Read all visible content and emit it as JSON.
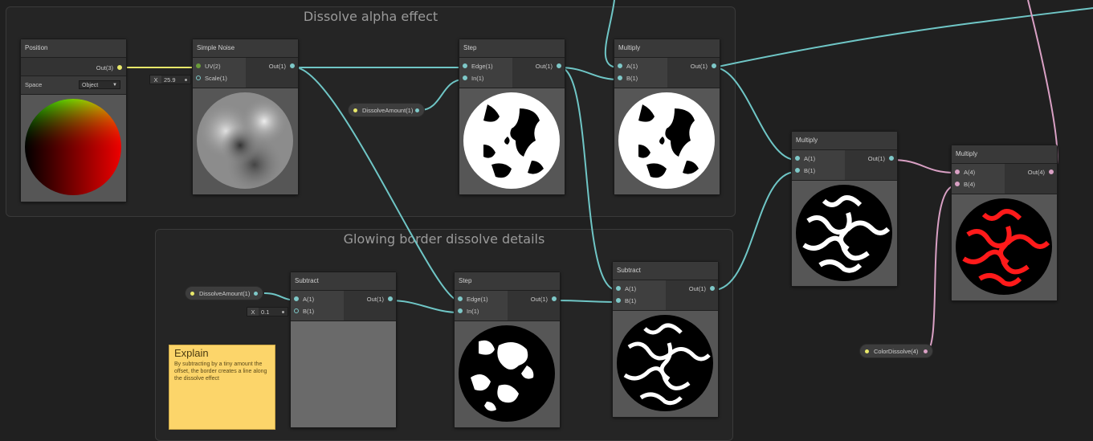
{
  "groups": {
    "dissolve_alpha": {
      "title": "Dissolve alpha effect"
    },
    "glowing_border": {
      "title": "Glowing border dissolve details"
    }
  },
  "nodes": {
    "position": {
      "title": "Position",
      "out": "Out(3)",
      "space_label": "Space",
      "space_value": "Object"
    },
    "simple_noise": {
      "title": "Simple Noise",
      "in1": "UV(2)",
      "in2": "Scale(1)",
      "out": "Out(1)",
      "scale_axis": "X",
      "scale_value": "25.9"
    },
    "step_top": {
      "title": "Step",
      "in1": "Edge(1)",
      "in2": "In(1)",
      "out": "Out(1)"
    },
    "multiply_top": {
      "title": "Multiply",
      "in1": "A(1)",
      "in2": "B(1)",
      "out": "Out(1)"
    },
    "multiply_mid": {
      "title": "Multiply",
      "in1": "A(1)",
      "in2": "B(1)",
      "out": "Out(1)"
    },
    "multiply_right": {
      "title": "Multiply",
      "in1": "A(4)",
      "in2": "B(4)",
      "out": "Out(4)"
    },
    "subtract_left": {
      "title": "Subtract",
      "in1": "A(1)",
      "in2": "B(1)",
      "out": "Out(1)",
      "b_axis": "X",
      "b_value": "0.1"
    },
    "step_bottom": {
      "title": "Step",
      "in1": "Edge(1)",
      "in2": "In(1)",
      "out": "Out(1)"
    },
    "subtract_right": {
      "title": "Subtract",
      "in1": "A(1)",
      "in2": "B(1)",
      "out": "Out(1)"
    }
  },
  "properties": {
    "dissolve_top": "DissolveAmount(1)",
    "dissolve_bottom": "DissolveAmount(1)",
    "color_dissolve": "ColorDissolve(4)"
  },
  "sticky_note": {
    "title": "Explain",
    "body": "By subtracting by a tiny amount the offset, the border creates a line along the dissolve effect"
  },
  "colors": {
    "background": "#202020",
    "wire_float": "#6fc6c6",
    "wire_vector4": "#d9a0c4",
    "wire_vector3": "#e8e86a",
    "sticky": "#fcd56a",
    "dissolve_red": "#ff1a1a"
  }
}
